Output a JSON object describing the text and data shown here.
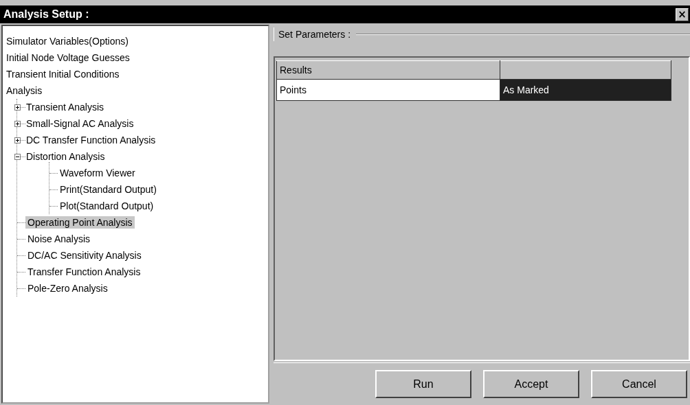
{
  "window": {
    "title": "Analysis Setup :",
    "close": "×"
  },
  "tree": [
    {
      "label": "Simulator Variables(Options)",
      "selected": false
    },
    {
      "label": "Initial Node Voltage Guesses",
      "selected": false
    },
    {
      "label": "Transient Initial Conditions",
      "selected": false
    },
    {
      "label": "Analysis",
      "selected": false,
      "children": [
        {
          "label": "Transient Analysis",
          "selected": false,
          "expandable": true,
          "expanded": false
        },
        {
          "label": "Small-Signal AC Analysis",
          "selected": false,
          "expandable": true,
          "expanded": false
        },
        {
          "label": "DC Transfer Function Analysis",
          "selected": false,
          "expandable": true,
          "expanded": false
        },
        {
          "label": "Distortion Analysis",
          "selected": false,
          "expandable": true,
          "expanded": true,
          "children": [
            {
              "label": "Waveform Viewer",
              "selected": false
            },
            {
              "label": "Print(Standard Output)",
              "selected": false
            },
            {
              "label": "Plot(Standard Output)",
              "selected": false
            }
          ]
        },
        {
          "label": "Operating Point Analysis",
          "selected": true
        },
        {
          "label": "Noise Analysis",
          "selected": false
        },
        {
          "label": "DC/AC Sensitivity Analysis",
          "selected": false
        },
        {
          "label": "Transfer Function Analysis",
          "selected": false
        },
        {
          "label": "Pole-Zero Analysis",
          "selected": false
        }
      ]
    }
  ],
  "group_title": "Set Parameters :",
  "table": {
    "columns": [
      "Results"
    ],
    "rows": [
      {
        "name": "Points",
        "value": "As Marked",
        "value_selected": true
      }
    ]
  },
  "buttons": [
    "Run",
    "Accept",
    "Cancel"
  ]
}
